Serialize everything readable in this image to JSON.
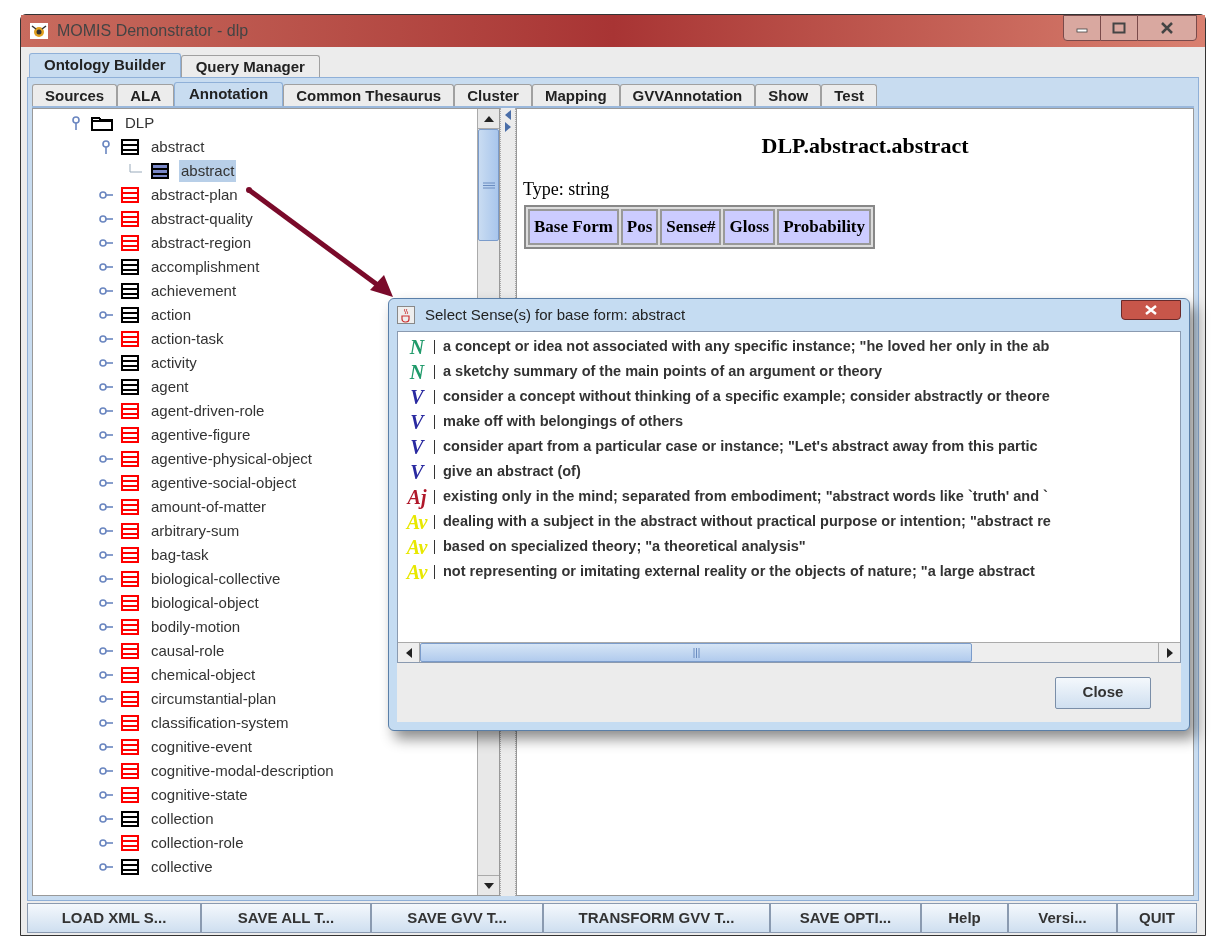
{
  "window": {
    "title": "MOMIS Demonstrator - dlp"
  },
  "main_tabs": [
    {
      "label": "Ontology Builder",
      "selected": true
    },
    {
      "label": "Query Manager",
      "selected": false
    }
  ],
  "sub_tabs": [
    {
      "label": "Sources",
      "selected": false
    },
    {
      "label": "ALA",
      "selected": false
    },
    {
      "label": "Annotation",
      "selected": true
    },
    {
      "label": "Common Thesaurus",
      "selected": false
    },
    {
      "label": "Cluster",
      "selected": false
    },
    {
      "label": "Mapping",
      "selected": false
    },
    {
      "label": "GVVAnnotation",
      "selected": false
    },
    {
      "label": "Show",
      "selected": false
    },
    {
      "label": "Test",
      "selected": false
    }
  ],
  "tree": [
    {
      "label": "DLP",
      "kind": "folder",
      "color": "#000000",
      "expanded": true,
      "selected": false,
      "children": [
        {
          "label": "abstract",
          "kind": "class",
          "color": "#000000",
          "expanded": true,
          "selected": false,
          "children": [
            {
              "label": "abstract",
              "kind": "attribute",
              "color": "#000000",
              "selected": true
            }
          ]
        },
        {
          "label": "abstract-plan",
          "kind": "class",
          "color": "#ff0000",
          "expanded": false,
          "selected": false
        },
        {
          "label": "abstract-quality",
          "kind": "class",
          "color": "#ff0000",
          "expanded": false,
          "selected": false
        },
        {
          "label": "abstract-region",
          "kind": "class",
          "color": "#ff0000",
          "expanded": false,
          "selected": false
        },
        {
          "label": "accomplishment",
          "kind": "class",
          "color": "#000000",
          "expanded": false,
          "selected": false
        },
        {
          "label": "achievement",
          "kind": "class",
          "color": "#000000",
          "expanded": false,
          "selected": false
        },
        {
          "label": "action",
          "kind": "class",
          "color": "#000000",
          "expanded": false,
          "selected": false
        },
        {
          "label": "action-task",
          "kind": "class",
          "color": "#ff0000",
          "expanded": false,
          "selected": false
        },
        {
          "label": "activity",
          "kind": "class",
          "color": "#000000",
          "expanded": false,
          "selected": false
        },
        {
          "label": "agent",
          "kind": "class",
          "color": "#000000",
          "expanded": false,
          "selected": false
        },
        {
          "label": "agent-driven-role",
          "kind": "class",
          "color": "#ff0000",
          "expanded": false,
          "selected": false
        },
        {
          "label": "agentive-figure",
          "kind": "class",
          "color": "#ff0000",
          "expanded": false,
          "selected": false
        },
        {
          "label": "agentive-physical-object",
          "kind": "class",
          "color": "#ff0000",
          "expanded": false,
          "selected": false
        },
        {
          "label": "agentive-social-object",
          "kind": "class",
          "color": "#ff0000",
          "expanded": false,
          "selected": false
        },
        {
          "label": "amount-of-matter",
          "kind": "class",
          "color": "#ff0000",
          "expanded": false,
          "selected": false
        },
        {
          "label": "arbitrary-sum",
          "kind": "class",
          "color": "#ff0000",
          "expanded": false,
          "selected": false
        },
        {
          "label": "bag-task",
          "kind": "class",
          "color": "#ff0000",
          "expanded": false,
          "selected": false
        },
        {
          "label": "biological-collective",
          "kind": "class",
          "color": "#ff0000",
          "expanded": false,
          "selected": false
        },
        {
          "label": "biological-object",
          "kind": "class",
          "color": "#ff0000",
          "expanded": false,
          "selected": false
        },
        {
          "label": "bodily-motion",
          "kind": "class",
          "color": "#ff0000",
          "expanded": false,
          "selected": false
        },
        {
          "label": "causal-role",
          "kind": "class",
          "color": "#ff0000",
          "expanded": false,
          "selected": false
        },
        {
          "label": "chemical-object",
          "kind": "class",
          "color": "#ff0000",
          "expanded": false,
          "selected": false
        },
        {
          "label": "circumstantial-plan",
          "kind": "class",
          "color": "#ff0000",
          "expanded": false,
          "selected": false
        },
        {
          "label": "classification-system",
          "kind": "class",
          "color": "#ff0000",
          "expanded": false,
          "selected": false
        },
        {
          "label": "cognitive-event",
          "kind": "class",
          "color": "#ff0000",
          "expanded": false,
          "selected": false
        },
        {
          "label": "cognitive-modal-description",
          "kind": "class",
          "color": "#ff0000",
          "expanded": false,
          "selected": false
        },
        {
          "label": "cognitive-state",
          "kind": "class",
          "color": "#ff0000",
          "expanded": false,
          "selected": false
        },
        {
          "label": "collection",
          "kind": "class",
          "color": "#000000",
          "expanded": false,
          "selected": false
        },
        {
          "label": "collection-role",
          "kind": "class",
          "color": "#ff0000",
          "expanded": false,
          "selected": false
        },
        {
          "label": "collective",
          "kind": "class",
          "color": "#000000",
          "expanded": false,
          "selected": false
        }
      ]
    }
  ],
  "detail": {
    "title": "DLP.abstract.abstract",
    "type_label": "Type: string",
    "columns": [
      "Base Form",
      "Pos",
      "Sense#",
      "Gloss",
      "Probability"
    ]
  },
  "dialog": {
    "title": "Select Sense(s) for base form: abstract",
    "senses": [
      {
        "pos": "N",
        "color": "#1f9a6a",
        "gloss": "a concept or idea not associated with any specific instance; \"he loved her only in the ab"
      },
      {
        "pos": "N",
        "color": "#1f9a6a",
        "gloss": "a sketchy summary of the main points of an argument or theory"
      },
      {
        "pos": "V",
        "color": "#2a2aa0",
        "gloss": "consider a concept without thinking of a specific example; consider abstractly or theore"
      },
      {
        "pos": "V",
        "color": "#2a2aa0",
        "gloss": "make off with belongings of others"
      },
      {
        "pos": "V",
        "color": "#2a2aa0",
        "gloss": "consider apart from a particular case or instance; \"Let's abstract away from this partic"
      },
      {
        "pos": "V",
        "color": "#2a2aa0",
        "gloss": "give an abstract (of)"
      },
      {
        "pos": "Aj",
        "color": "#b0182a",
        "gloss": "existing only in the mind; separated from embodiment; \"abstract words like `truth' and `"
      },
      {
        "pos": "Av",
        "color": "#e8e800",
        "gloss": "dealing with a subject in the abstract without practical purpose or intention; \"abstract re"
      },
      {
        "pos": "Av",
        "color": "#e8e800",
        "gloss": "based on specialized theory; \"a theoretical analysis\""
      },
      {
        "pos": "Av",
        "color": "#e8e800",
        "gloss": "not representing or imitating external reality or the objects of nature; \"a large abstract"
      }
    ],
    "close_button": "Close"
  },
  "bottom_buttons": [
    "LOAD XML S...",
    "SAVE ALL T...",
    "SAVE GVV T...",
    "TRANSFORM GVV T...",
    "SAVE OPTI...",
    "Help",
    "Versi...",
    "QUIT"
  ]
}
